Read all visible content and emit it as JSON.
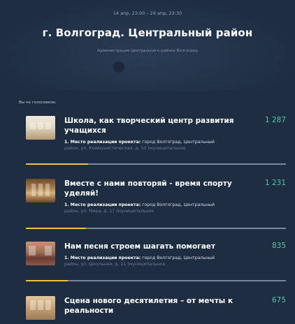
{
  "header": {
    "dates": "14 апр, 23:00 – 29 апр, 23:30",
    "title": "г. Волгоград. Центральный район",
    "subtitle": "Администрация Центрального района Волгоград"
  },
  "vote_status": "Вы не голосовали.",
  "projects": [
    {
      "title": "Школа, как творческий центр развития учащихся",
      "votes": "1 287",
      "desc_label": "1. Место реализации проекта:",
      "desc_text": " город Волгоград, Центральный",
      "desc_more": "район, ул. Коммунистическая, д. 50 (муниципальное",
      "progress": 0.24
    },
    {
      "title": "Вместе с нами повторяй - время спорту уделяй!",
      "votes": "1 231",
      "desc_label": "1. Место реализации проекта:",
      "desc_text": " город Волгоград, Центральный",
      "desc_more": "район, ул. Мира, д. 17 (муниципальное",
      "progress": 0.23
    },
    {
      "title": "Нам песня строем шагать помогает",
      "votes": "835",
      "desc_label": "1. Место реализации проекта:",
      "desc_text": " город Волгоград, Центральный",
      "desc_more": "район, ул. Школьная, д. 11 (муниципальное",
      "progress": 0.16
    },
    {
      "title": "Сцена нового десятилетия – от мечты к реальности",
      "votes": "675",
      "progress": 0.13
    }
  ],
  "colors": {
    "background": "#1e2d42",
    "vote_count": "#52c7ac",
    "progress_fill": "#f0c43f",
    "progress_track": "#7a8699"
  }
}
